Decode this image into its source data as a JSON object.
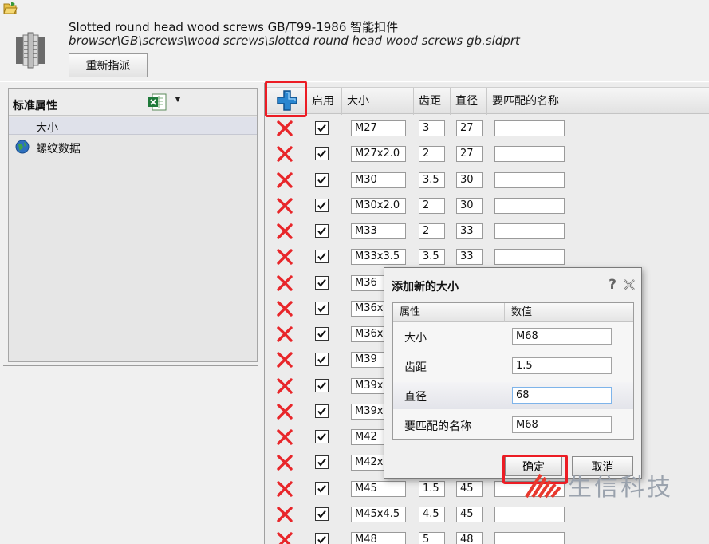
{
  "header": {
    "title": "Slotted round head wood screws GB/T99-1986 智能扣件",
    "path": "browser\\GB\\screws\\wood screws\\slotted round head wood screws gb.sldprt",
    "reassign_label": "重新指派"
  },
  "left_panel": {
    "header_label": "标准属性",
    "items": [
      {
        "label": "大小"
      },
      {
        "label": "螺纹数据",
        "icon": "globe-icon"
      }
    ]
  },
  "grid": {
    "columns": [
      "启用",
      "大小",
      "齿距",
      "直径",
      "要匹配的名称"
    ],
    "rows": [
      {
        "size": "M27",
        "pitch": "3",
        "diameter": "27",
        "name": ""
      },
      {
        "size": "M27x2.0",
        "pitch": "2",
        "diameter": "27",
        "name": ""
      },
      {
        "size": "M30",
        "pitch": "3.5",
        "diameter": "30",
        "name": ""
      },
      {
        "size": "M30x2.0",
        "pitch": "2",
        "diameter": "30",
        "name": ""
      },
      {
        "size": "M33",
        "pitch": "2",
        "diameter": "33",
        "name": ""
      },
      {
        "size": "M33x3.5",
        "pitch": "3.5",
        "diameter": "33",
        "name": ""
      },
      {
        "size": "M36",
        "pitch": "",
        "diameter": "",
        "name": ""
      },
      {
        "size": "M36x2",
        "pitch": "",
        "diameter": "",
        "name": ""
      },
      {
        "size": "M36x3",
        "pitch": "",
        "diameter": "",
        "name": ""
      },
      {
        "size": "M39",
        "pitch": "",
        "diameter": "",
        "name": ""
      },
      {
        "size": "M39x3",
        "pitch": "",
        "diameter": "",
        "name": ""
      },
      {
        "size": "M39x4",
        "pitch": "",
        "diameter": "",
        "name": ""
      },
      {
        "size": "M42",
        "pitch": "",
        "diameter": "",
        "name": ""
      },
      {
        "size": "M42x3",
        "pitch": "",
        "diameter": "",
        "name": ""
      },
      {
        "size": "M45",
        "pitch": "1.5",
        "diameter": "45",
        "name": ""
      },
      {
        "size": "M45x4.5",
        "pitch": "4.5",
        "diameter": "45",
        "name": ""
      },
      {
        "size": "M48",
        "pitch": "5",
        "diameter": "48",
        "name": ""
      }
    ]
  },
  "dialog": {
    "title": "添加新的大小",
    "help": "?",
    "col_property": "属性",
    "col_value": "数值",
    "fields": [
      {
        "label": "大小",
        "value": "M68"
      },
      {
        "label": "齿距",
        "value": "1.5"
      },
      {
        "label": "直径",
        "value": "68"
      },
      {
        "label": "要匹配的名称",
        "value": "M68"
      }
    ],
    "ok_label": "确定",
    "cancel_label": "取消"
  },
  "watermark": {
    "text": "生信科技"
  },
  "colors": {
    "highlight": "#ec1c24",
    "delete": "#e8262a",
    "add": "#1a78c2"
  }
}
